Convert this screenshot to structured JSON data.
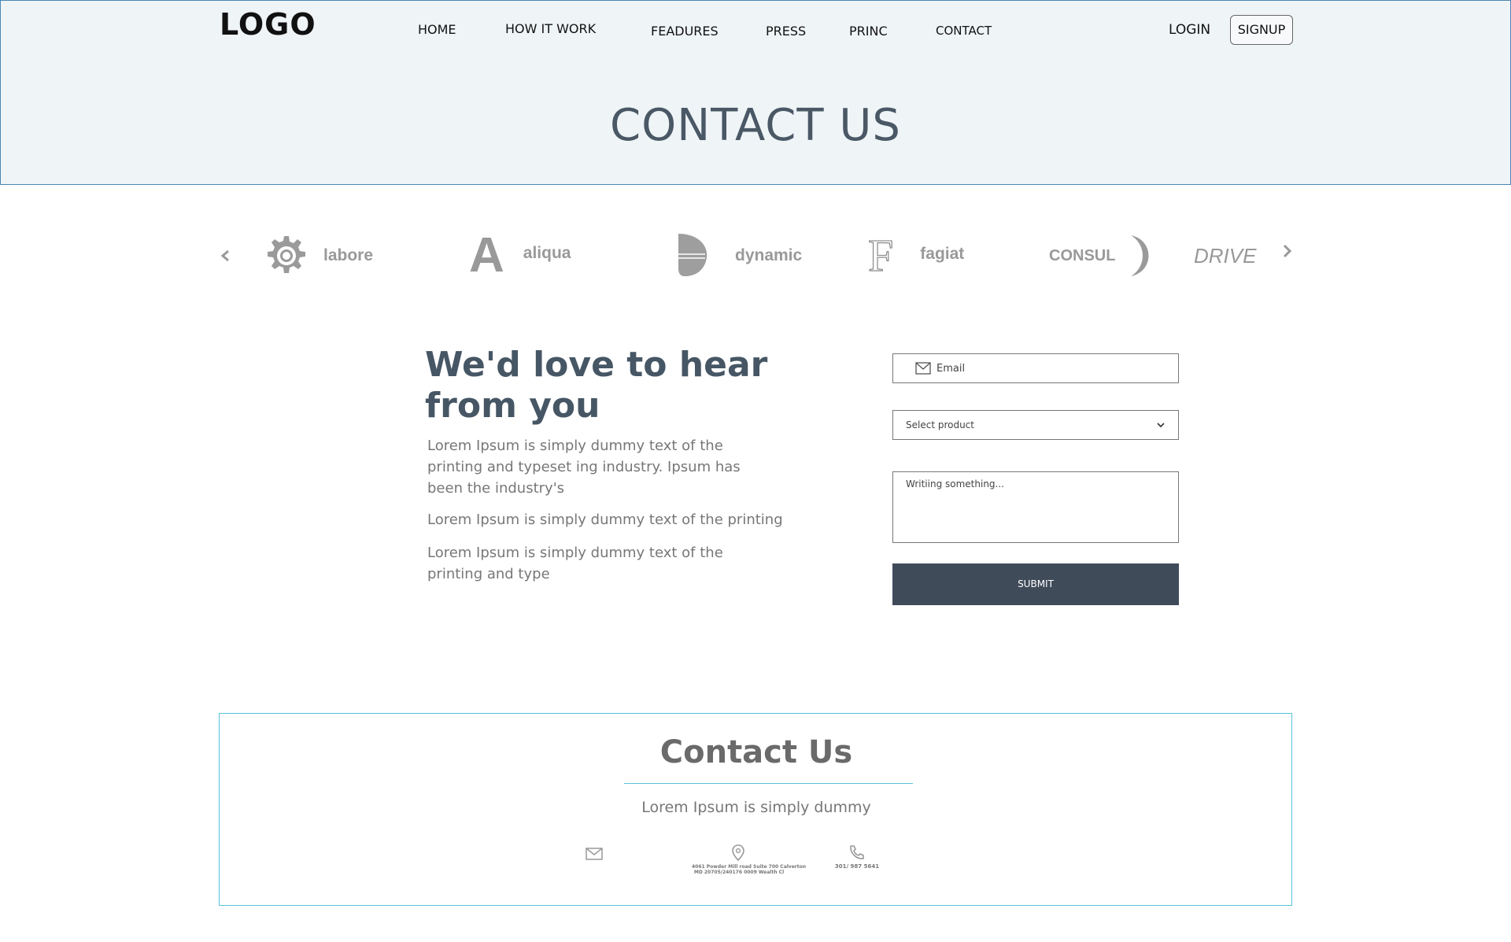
{
  "header": {
    "logo": "LOGO",
    "nav": [
      "HOME",
      "HOW IT WORK",
      "FEADURES",
      "PRESS",
      "PRINC",
      "CONTACT"
    ],
    "login": "LOGIN",
    "signup": "SIGNUP",
    "title": "CONTACT US"
  },
  "brands": [
    {
      "label": "labore",
      "icon": "gear-icon"
    },
    {
      "label": "aliqua",
      "icon": "letter-a-icon"
    },
    {
      "label": "dynamic",
      "icon": "shield-shape-icon"
    },
    {
      "label": "fagiat",
      "icon": "letter-f-icon"
    },
    {
      "label": "CONSUL",
      "icon": "crescent-icon"
    },
    {
      "label": "DRIVE",
      "icon": "drive-wordmark"
    }
  ],
  "brand_glyphs": {
    "a": "A",
    "f": "F"
  },
  "intro": {
    "headline": "We'd love to hear from you",
    "paragraphs": [
      "Lorem Ipsum is simply dummy text of the printing and typeset  ing    industry.   Ipsum  has been the industry's",
      "Lorem Ipsum is simply dummy text of the printing",
      "Lorem Ipsum is simply dummy text of the printing and type"
    ]
  },
  "form": {
    "email_placeholder": "Email",
    "select_value": "Select product",
    "textarea_placeholder": "Writiing something...",
    "submit": "SUBMIT"
  },
  "contact": {
    "title": "Contact Us",
    "subtitle": "Lorem Ipsum is simply dummy",
    "address_line1": "4061 Powder Mill road Suite 700 Calverton",
    "address_line2": "MD 20705/240176 0009 Wealth Cl",
    "phone": "301/ 987 5641"
  },
  "colors": {
    "header_bg": "#eff4f7",
    "title": "#4a5866",
    "submit_bg": "#404b5a",
    "accent_border": "#5ac2db"
  }
}
